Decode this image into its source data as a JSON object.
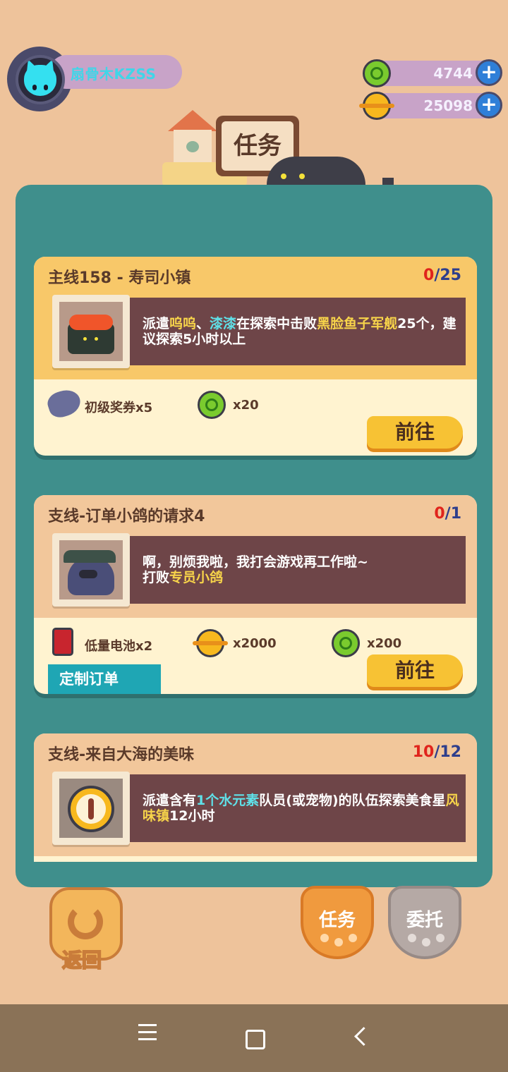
{
  "player": {
    "name": "扇骨木KZSS"
  },
  "currencies": [
    {
      "icon": "green-coin-icon",
      "value": "4744"
    },
    {
      "icon": "gold-coin-icon",
      "value": "25098"
    }
  ],
  "header": {
    "title": "任务"
  },
  "quests": [
    {
      "title": "主线158 - 寿司小镇",
      "progress_current": "0",
      "progress_total": "/25",
      "desc_parts": [
        "派遣",
        "呜呜",
        "、",
        "漆漆",
        "在探索中击败",
        "黑脸鱼子军舰",
        "25个，建议探索5小时以上"
      ],
      "rewards": [
        {
          "icon": "coupon-icon",
          "label": "初级奖券x5"
        },
        {
          "icon": "green-coin-icon",
          "label": "x20"
        }
      ],
      "button": "前往"
    },
    {
      "title": "支线-订单小鸽的请求4",
      "progress_current": "0",
      "progress_total": "/1",
      "desc_parts": [
        "啊，别烦我啦，我打会游戏再工作啦~",
        "打败",
        "专员小鸽"
      ],
      "rewards": [
        {
          "icon": "low-battery-icon",
          "label": "低量电池x2"
        },
        {
          "icon": "gold-coin-icon",
          "label": "x2000"
        },
        {
          "icon": "green-coin-icon",
          "label": "x200"
        }
      ],
      "tag": "定制订单",
      "button": "前往"
    },
    {
      "title": "支线-来自大海的美味",
      "progress_current": "10",
      "progress_total": "/12",
      "desc_parts": [
        "派遣含有",
        "1个水元素",
        "队员(或宠物)的队伍探索美食星",
        "风味镇",
        "12小时"
      ]
    }
  ],
  "bottom": {
    "back_label": "返回",
    "tabs": [
      {
        "label": "任务",
        "active": true
      },
      {
        "label": "委托",
        "active": false
      }
    ]
  },
  "system_nav": [
    {
      "icon": "menu-icon"
    },
    {
      "icon": "home-icon"
    },
    {
      "icon": "back-arrow-icon"
    }
  ],
  "colors": {
    "panel": "#3F8F8C",
    "card": "#FFF3D0",
    "card_main_head": "#F8C869",
    "desc_box": "#6E4548",
    "accent_button": "#F7C234"
  }
}
